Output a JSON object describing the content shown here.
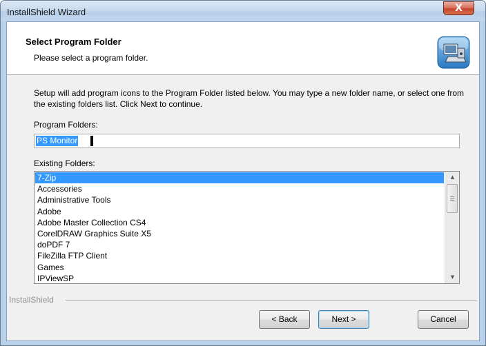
{
  "window": {
    "title": "InstallShield Wizard",
    "close_glyph": "X"
  },
  "header": {
    "title": "Select Program Folder",
    "subtitle": "Please select a program folder.",
    "icon": "setup-computer-icon"
  },
  "body": {
    "description": "Setup will add program icons to the Program Folder listed below.  You may type a new folder name, or select one from the existing folders list.  Click Next to continue.",
    "program_folders_label": "Program Folders:",
    "program_folder_value": "PS Monitor",
    "existing_folders_label": "Existing Folders:",
    "existing_folders": [
      "7-Zip",
      "Accessories",
      "Administrative Tools",
      "Adobe",
      "Adobe Master Collection CS4",
      "CorelDRAW Graphics Suite X5",
      "doPDF 7",
      "FileZilla FTP Client",
      "Games",
      "IPViewSP"
    ],
    "selected_folder": "7-Zip"
  },
  "footer": {
    "brand": "InstallShield",
    "back_label": "< Back",
    "next_label": "Next >",
    "cancel_label": "Cancel"
  },
  "colors": {
    "selection": "#3399ff",
    "close_button": "#c7452d",
    "titlebar": "#c8dbef"
  }
}
